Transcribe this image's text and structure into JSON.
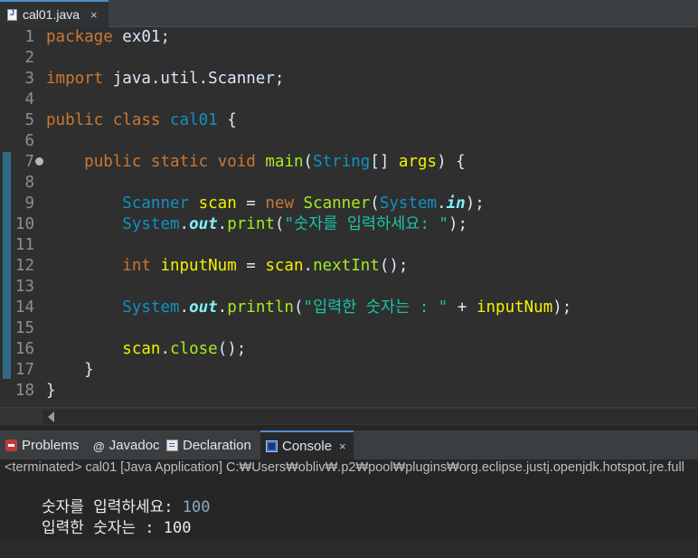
{
  "editor_tab": {
    "label": "cal01.java",
    "close": "×"
  },
  "code_lines": [
    {
      "n": "1",
      "tokens": [
        [
          "kw",
          "package"
        ],
        [
          "plain",
          " ex01;"
        ]
      ]
    },
    {
      "n": "2",
      "tokens": []
    },
    {
      "n": "3",
      "tokens": [
        [
          "kw",
          "import"
        ],
        [
          "plain",
          " java.util.Scanner;"
        ]
      ]
    },
    {
      "n": "4",
      "tokens": []
    },
    {
      "n": "5",
      "tokens": [
        [
          "kw",
          "public"
        ],
        [
          "plain",
          " "
        ],
        [
          "kw",
          "class"
        ],
        [
          "plain",
          " "
        ],
        [
          "cname",
          "cal01"
        ],
        [
          "plain",
          " {"
        ]
      ]
    },
    {
      "n": "6",
      "tokens": []
    },
    {
      "n": "7",
      "fold": true,
      "tokens": [
        [
          "plain",
          "    "
        ],
        [
          "kw",
          "public"
        ],
        [
          "plain",
          " "
        ],
        [
          "kw",
          "static"
        ],
        [
          "plain",
          " "
        ],
        [
          "kw",
          "void"
        ],
        [
          "plain",
          " "
        ],
        [
          "fn",
          "main"
        ],
        [
          "plain",
          "("
        ],
        [
          "cls",
          "String"
        ],
        [
          "plain",
          "[] "
        ],
        [
          "var",
          "args"
        ],
        [
          "plain",
          ") {"
        ]
      ]
    },
    {
      "n": "8",
      "tokens": []
    },
    {
      "n": "9",
      "tokens": [
        [
          "plain",
          "        "
        ],
        [
          "cls",
          "Scanner"
        ],
        [
          "plain",
          " "
        ],
        [
          "var",
          "scan"
        ],
        [
          "plain",
          " = "
        ],
        [
          "kw",
          "new"
        ],
        [
          "plain",
          " "
        ],
        [
          "fn",
          "Scanner"
        ],
        [
          "plain",
          "("
        ],
        [
          "cls",
          "System"
        ],
        [
          "plain",
          "."
        ],
        [
          "static",
          "in"
        ],
        [
          "plain",
          ");"
        ]
      ]
    },
    {
      "n": "10",
      "tokens": [
        [
          "plain",
          "        "
        ],
        [
          "cls",
          "System"
        ],
        [
          "plain",
          "."
        ],
        [
          "static",
          "out"
        ],
        [
          "plain",
          "."
        ],
        [
          "fn",
          "print"
        ],
        [
          "plain",
          "("
        ],
        [
          "str",
          "\"숫자를 입력하세요: \""
        ],
        [
          "plain",
          ");"
        ]
      ]
    },
    {
      "n": "11",
      "tokens": []
    },
    {
      "n": "12",
      "tokens": [
        [
          "plain",
          "        "
        ],
        [
          "kw",
          "int"
        ],
        [
          "plain",
          " "
        ],
        [
          "var",
          "inputNum"
        ],
        [
          "plain",
          " = "
        ],
        [
          "var",
          "scan"
        ],
        [
          "plain",
          "."
        ],
        [
          "fn",
          "nextInt"
        ],
        [
          "plain",
          "();"
        ]
      ]
    },
    {
      "n": "13",
      "tokens": []
    },
    {
      "n": "14",
      "tokens": [
        [
          "plain",
          "        "
        ],
        [
          "cls",
          "System"
        ],
        [
          "plain",
          "."
        ],
        [
          "static",
          "out"
        ],
        [
          "plain",
          "."
        ],
        [
          "fn",
          "println"
        ],
        [
          "plain",
          "("
        ],
        [
          "str",
          "\"입력한 숫자는 : \""
        ],
        [
          "plain",
          " + "
        ],
        [
          "var",
          "inputNum"
        ],
        [
          "plain",
          ");"
        ]
      ]
    },
    {
      "n": "15",
      "tokens": []
    },
    {
      "n": "16",
      "tokens": [
        [
          "plain",
          "        "
        ],
        [
          "var",
          "scan"
        ],
        [
          "plain",
          "."
        ],
        [
          "fn",
          "close"
        ],
        [
          "plain",
          "();"
        ]
      ]
    },
    {
      "n": "17",
      "tokens": [
        [
          "plain",
          "    }"
        ]
      ]
    },
    {
      "n": "18",
      "tokens": [
        [
          "plain",
          "}"
        ]
      ]
    }
  ],
  "panel_tabs": [
    {
      "name": "problems",
      "label": "Problems",
      "icon": "problems-icon"
    },
    {
      "name": "javadoc",
      "label": "Javadoc",
      "icon": "javadoc-icon",
      "glyph": "@"
    },
    {
      "name": "declaration",
      "label": "Declaration",
      "icon": "declaration-icon"
    },
    {
      "name": "console",
      "label": "Console",
      "icon": "console-icon",
      "active": true,
      "close": "×"
    }
  ],
  "console": {
    "status": "<terminated> cal01 [Java Application] C:₩Users₩obliv₩.p2₩pool₩plugins₩org.eclipse.justj.openjdk.hotspot.jre.full",
    "lines": [
      {
        "prompt": "숫자를 입력하세요: ",
        "input": "100"
      },
      {
        "prompt": "입력한 숫자는 : 100",
        "input": ""
      }
    ]
  },
  "colors": {
    "keyword": "#cc7832",
    "class": "#1290c3",
    "method": "#a7ec21",
    "variable": "#f2f200",
    "string": "#17c6a3",
    "static_field": "#80f2f6",
    "active_tab_accent": "#4e8fca"
  }
}
